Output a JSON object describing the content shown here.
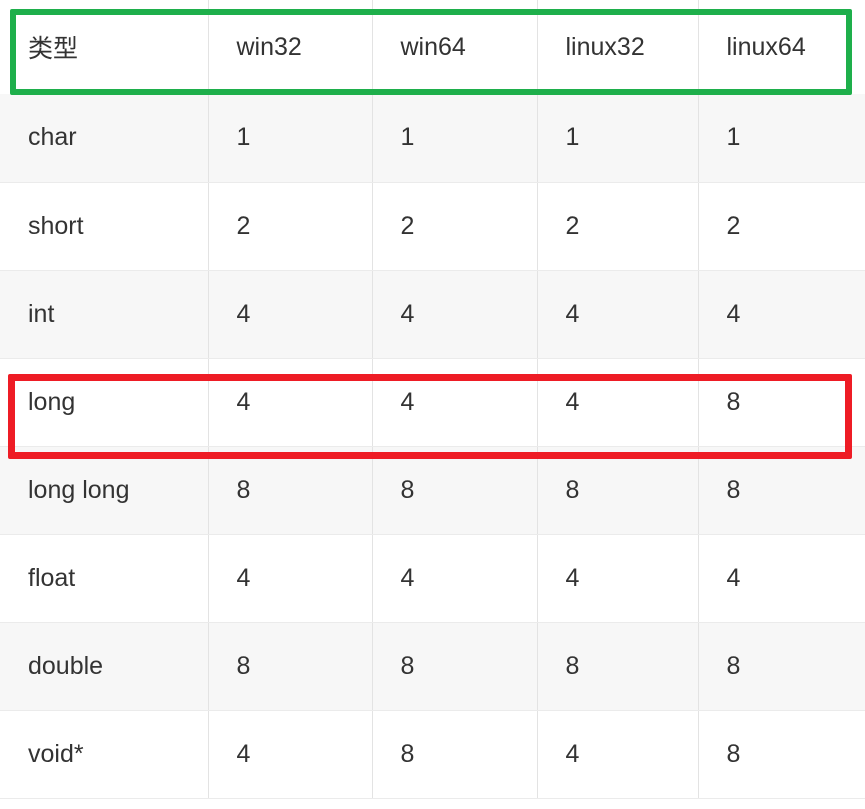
{
  "table": {
    "columns": [
      "类型",
      "win32",
      "win64",
      "linux32",
      "linux64"
    ],
    "rows": [
      {
        "type": "char",
        "values": [
          "1",
          "1",
          "1",
          "1"
        ]
      },
      {
        "type": "short",
        "values": [
          "2",
          "2",
          "2",
          "2"
        ]
      },
      {
        "type": "int",
        "values": [
          "4",
          "4",
          "4",
          "4"
        ]
      },
      {
        "type": "long",
        "values": [
          "4",
          "4",
          "4",
          "8"
        ]
      },
      {
        "type": "long long",
        "values": [
          "8",
          "8",
          "8",
          "8"
        ]
      },
      {
        "type": "float",
        "values": [
          "4",
          "4",
          "4",
          "4"
        ]
      },
      {
        "type": "double",
        "values": [
          "8",
          "8",
          "8",
          "8"
        ]
      },
      {
        "type": "void*",
        "values": [
          "4",
          "8",
          "4",
          "8"
        ]
      }
    ]
  },
  "annotations": {
    "header_highlight": {
      "label": "header-row-highlight",
      "color": "#1eaf4b"
    },
    "long_row_highlight": {
      "label": "long-row-highlight",
      "color": "#ee1c25"
    }
  },
  "colors": {
    "text": "#333333",
    "emphasis_red": "#fa3c3c",
    "muted": "#8d8d8d",
    "row_shade": "#f7f7f7",
    "row_plain": "#ffffff",
    "grid_line": "#e7e7e7",
    "green_box": "#1eaf4b",
    "red_box": "#ee1c25"
  }
}
